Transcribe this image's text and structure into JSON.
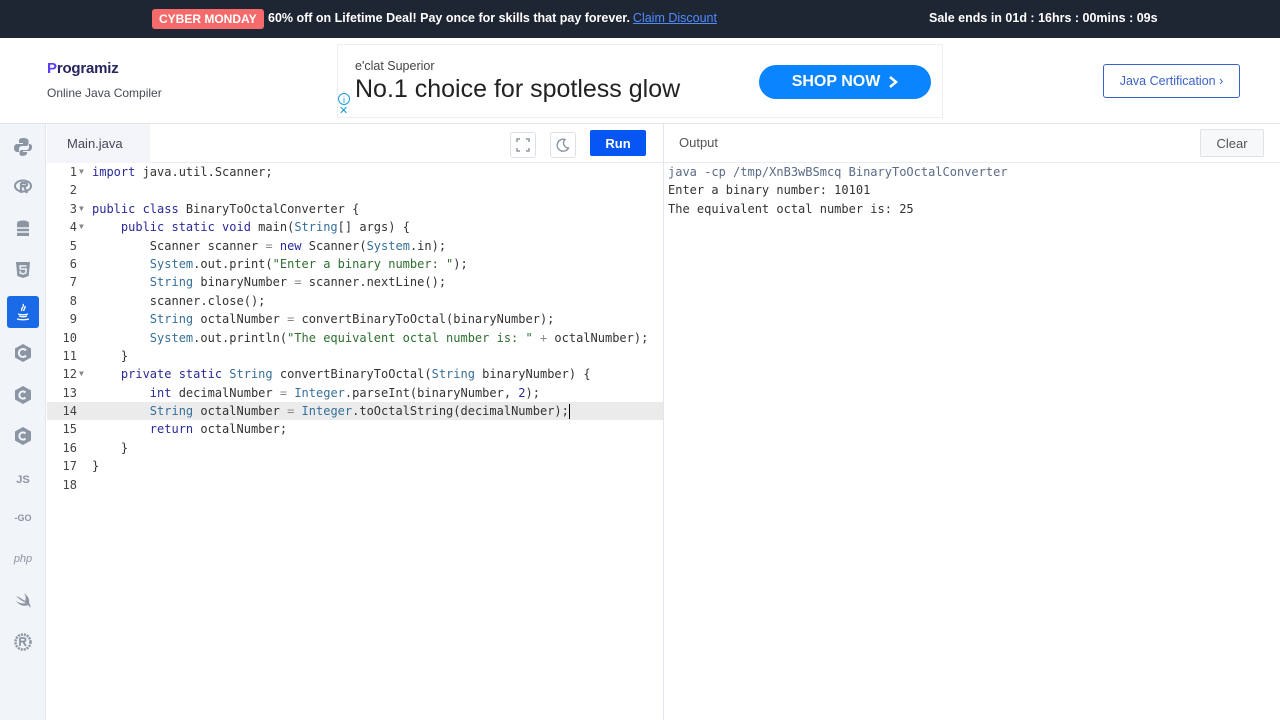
{
  "promo": {
    "badge": "CYBER MONDAY",
    "text": "60% off on Lifetime Deal! Pay once for skills that pay forever.",
    "link": "Claim Discount",
    "timer": "Sale ends in 01d : 16hrs : 00mins : 09s"
  },
  "header": {
    "logo_p": "P",
    "logo_rest": "rogramiz",
    "subtitle": "Online Java Compiler",
    "ad_brand": "e'clat Superior",
    "ad_headline": "No.1 choice for spotless glow",
    "ad_button": "SHOP NOW",
    "ad_info": "i",
    "ad_close": "✕",
    "cert_button": "Java Certification ›"
  },
  "sidebar": {
    "items": [
      {
        "name": "python-icon",
        "label": ""
      },
      {
        "name": "r-icon",
        "label": ""
      },
      {
        "name": "sql-icon",
        "label": ""
      },
      {
        "name": "html-icon",
        "label": ""
      },
      {
        "name": "java-icon",
        "label": ""
      },
      {
        "name": "c-icon",
        "label": ""
      },
      {
        "name": "cpp-icon",
        "label": ""
      },
      {
        "name": "csharp-icon",
        "label": ""
      },
      {
        "name": "js-icon",
        "label": "JS"
      },
      {
        "name": "go-icon",
        "label": "-GO"
      },
      {
        "name": "php-icon",
        "label": "php"
      },
      {
        "name": "swift-icon",
        "label": ""
      },
      {
        "name": "rust-icon",
        "label": ""
      }
    ]
  },
  "editor": {
    "file_tab": "Main.java",
    "run_label": "Run",
    "line_numbers": [
      "1",
      "2",
      "3",
      "4",
      "5",
      "6",
      "7",
      "8",
      "9",
      "10",
      "11",
      "12",
      "13",
      "14",
      "15",
      "16",
      "17",
      "18"
    ]
  },
  "output": {
    "title": "Output",
    "clear_label": "Clear",
    "lines": [
      "java -cp /tmp/XnB3wBSmcq BinaryToOctalConverter",
      "Enter a binary number: 10101",
      "The equivalent octal number is: 25"
    ]
  },
  "code": {
    "l1a": "import",
    "l1b": " java.util.Scanner;",
    "l3a": "public class",
    "l3b": " BinaryToOctalConverter {",
    "l4a": "    public static void",
    "l4b": " main(",
    "l4c": "String",
    "l4d": "[] args) {",
    "l5a": "        Scanner scanner ",
    "l5b": "=",
    "l5c": " ",
    "l5d": "new",
    "l5e": " Scanner(",
    "l5f": "System",
    "l5g": ".in);",
    "l6a": "        ",
    "l6b": "System",
    "l6c": ".out.print(",
    "l6d": "\"Enter a binary number: \"",
    "l6e": ");",
    "l7a": "        ",
    "l7b": "String",
    "l7c": " binaryNumber ",
    "l7d": "=",
    "l7e": " scanner.nextLine();",
    "l8a": "        scanner.close();",
    "l9a": "        ",
    "l9b": "String",
    "l9c": " octalNumber ",
    "l9d": "=",
    "l9e": " convertBinaryToOctal(binaryNumber);",
    "l10a": "        ",
    "l10b": "System",
    "l10c": ".out.println(",
    "l10d": "\"The equivalent octal number is: \"",
    "l10e": " ",
    "l10f": "+",
    "l10g": " octalNumber);",
    "l11a": "    }",
    "l12a": "    private static",
    "l12b": " ",
    "l12c": "String",
    "l12d": " convertBinaryToOctal(",
    "l12e": "String",
    "l12f": " binaryNumber) {",
    "l13a": "        ",
    "l13b": "int",
    "l13c": " decimalNumber ",
    "l13d": "=",
    "l13e": " ",
    "l13f": "Integer",
    "l13g": ".parseInt(binaryNumber, ",
    "l13h": "2",
    "l13i": ");",
    "l14a": "        ",
    "l14b": "String",
    "l14c": " octalNumber ",
    "l14d": "=",
    "l14e": " ",
    "l14f": "Integer",
    "l14g": ".toOctalString(decimalNumber);",
    "l15a": "        ",
    "l15b": "return",
    "l15c": " octalNumber;",
    "l16a": "    }",
    "l17a": "}"
  }
}
